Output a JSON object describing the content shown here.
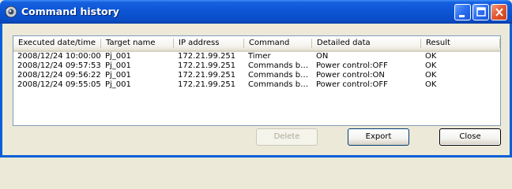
{
  "window": {
    "title": "Command history",
    "icon": "projector-app-icon"
  },
  "table": {
    "columns": [
      "Executed date/time",
      "Target name",
      "IP address",
      "Command",
      "Detailed data",
      "Result"
    ],
    "rows": [
      [
        "2008/12/24 10:00:00",
        "Pj_001",
        "172.21.99.251",
        "Timer",
        "ON",
        "OK"
      ],
      [
        "2008/12/24 09:57:53",
        "Pj_001",
        "172.21.99.251",
        "Commands b…",
        "Power control:OFF",
        "OK"
      ],
      [
        "2008/12/24 09:56:22",
        "Pj_001",
        "172.21.99.251",
        "Commands b…",
        "Power control:ON",
        "OK"
      ],
      [
        "2008/12/24 09:55:05",
        "Pj_001",
        "172.21.99.251",
        "Commands b…",
        "Power control:OFF",
        "OK"
      ]
    ]
  },
  "buttons": {
    "delete": "Delete",
    "export": "Export",
    "close": "Close"
  }
}
